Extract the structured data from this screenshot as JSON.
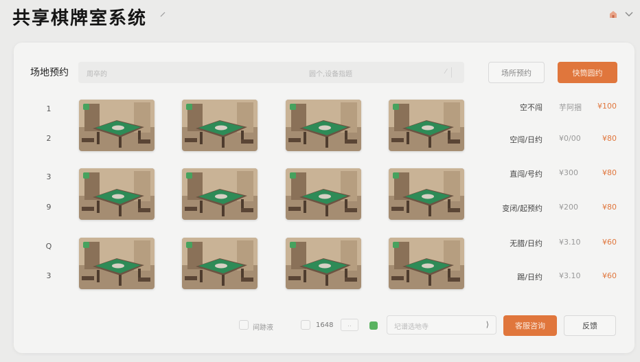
{
  "app": {
    "title": "共享棋牌室系统"
  },
  "header": {
    "icons": [
      "edit-icon",
      "house-icon",
      "chevron-down-icon"
    ]
  },
  "booking": {
    "section_title": "场地预约",
    "search": {
      "placeholder_left": "周卒的",
      "placeholder_right": "圆个,设备指题",
      "slash": "⁄"
    },
    "reserve_button": "场所预约",
    "quick_button": "快筒圆约"
  },
  "row_numbers": [
    "1",
    "2",
    "3",
    "9",
    "Q",
    "3"
  ],
  "rooms": {
    "count_per_row": 4,
    "rows": 3,
    "tag_color": "#46a25e",
    "table_color": "#2e8b57"
  },
  "prices": [
    {
      "status": "空不闯",
      "p1": "芋阿捆",
      "p2": "¥100"
    },
    {
      "status": "空闯/日约",
      "p1": "¥0/00",
      "p2": "¥80"
    },
    {
      "status": "直闯/号约",
      "p1": "¥300",
      "p2": "¥80"
    },
    {
      "status": "变闭/起预约",
      "p1": "¥200",
      "p2": "¥80"
    },
    {
      "status": "无腊/日约",
      "p1": "¥3.10",
      "p2": "¥60"
    },
    {
      "status": "踢/日约",
      "p1": "¥3.10",
      "p2": "¥60"
    }
  ],
  "footer": {
    "checkbox_label": "间跡液",
    "number_label": "1648",
    "small_box": "..",
    "select_placeholder": "圮谱选地寺",
    "select_arrow": "⟩",
    "query_button": "客服咨询",
    "feedback_button": "反馈"
  },
  "colors": {
    "accent": "#e0763c",
    "panel": "#f4f4f3",
    "background": "#ebebea"
  }
}
